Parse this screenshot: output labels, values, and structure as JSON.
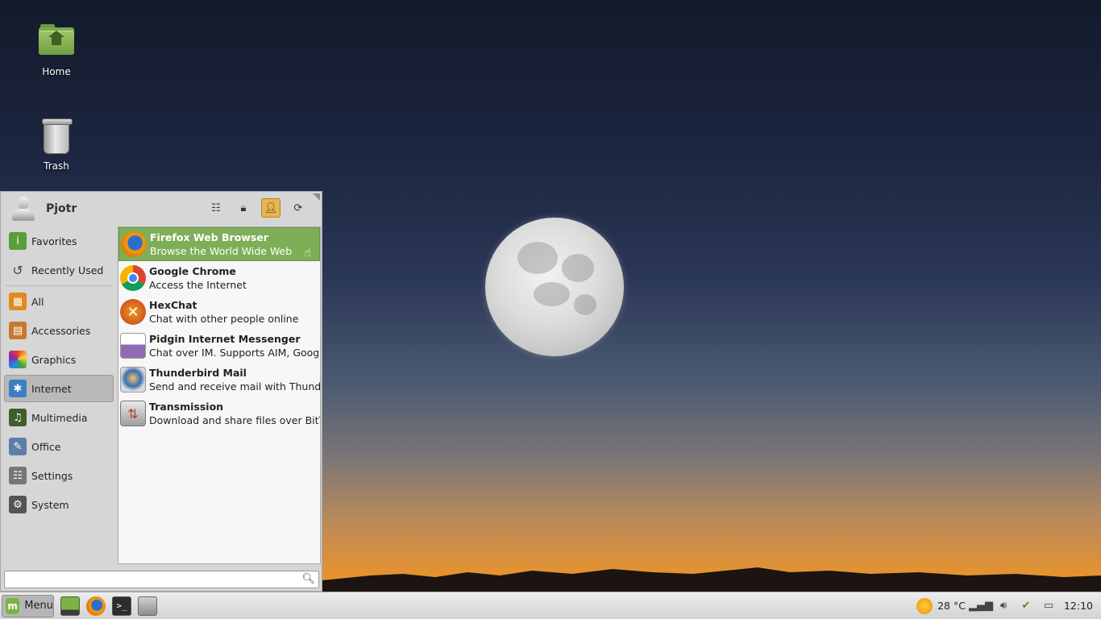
{
  "desktop": {
    "icons": [
      {
        "label": "Home",
        "icon": "home-folder-icon"
      },
      {
        "label": "Trash",
        "icon": "trash-icon"
      }
    ]
  },
  "menu": {
    "username": "Pjotr",
    "system_buttons": [
      "settings-icon",
      "lock-icon",
      "user-switch-icon",
      "refresh-icon"
    ],
    "categories": [
      {
        "label": "Favorites",
        "icon": "info-icon",
        "color": "#5a9e3a"
      },
      {
        "label": "Recently Used",
        "icon": "history-icon",
        "color": "#444444"
      },
      {
        "label": "All",
        "icon": "all-icon",
        "color": "#e08a1e"
      },
      {
        "label": "Accessories",
        "icon": "accessories-icon",
        "color": "#c77a2e"
      },
      {
        "label": "Graphics",
        "icon": "graphics-icon",
        "color": "#d33b8f"
      },
      {
        "label": "Internet",
        "icon": "internet-icon",
        "color": "#3a7fc4",
        "selected": true
      },
      {
        "label": "Multimedia",
        "icon": "multimedia-icon",
        "color": "#3f5e2a"
      },
      {
        "label": "Office",
        "icon": "office-icon",
        "color": "#5c7fa8"
      },
      {
        "label": "Settings",
        "icon": "settings-icon",
        "color": "#777777"
      },
      {
        "label": "System",
        "icon": "system-icon",
        "color": "#555555"
      }
    ],
    "apps": [
      {
        "name": "Firefox Web Browser",
        "desc": "Browse the World Wide Web",
        "icon": "firefox-icon",
        "hover": true
      },
      {
        "name": "Google Chrome",
        "desc": "Access the Internet",
        "icon": "chrome-icon"
      },
      {
        "name": "HexChat",
        "desc": "Chat with other people online",
        "icon": "hexchat-icon"
      },
      {
        "name": "Pidgin Internet Messenger",
        "desc": "Chat over IM.  Supports AIM, Googl...",
        "icon": "pidgin-icon"
      },
      {
        "name": "Thunderbird Mail",
        "desc": "Send and receive mail with Thunde...",
        "icon": "thunderbird-icon"
      },
      {
        "name": "Transmission",
        "desc": "Download and share files over BitT...",
        "icon": "transmission-icon"
      }
    ],
    "search": {
      "value": "",
      "placeholder": ""
    }
  },
  "taskbar": {
    "menu_label": "Menu",
    "launchers": [
      "show-desktop-icon",
      "firefox-icon",
      "terminal-icon",
      "window-icon"
    ],
    "weather": "28 °C",
    "clock": "12:10"
  }
}
